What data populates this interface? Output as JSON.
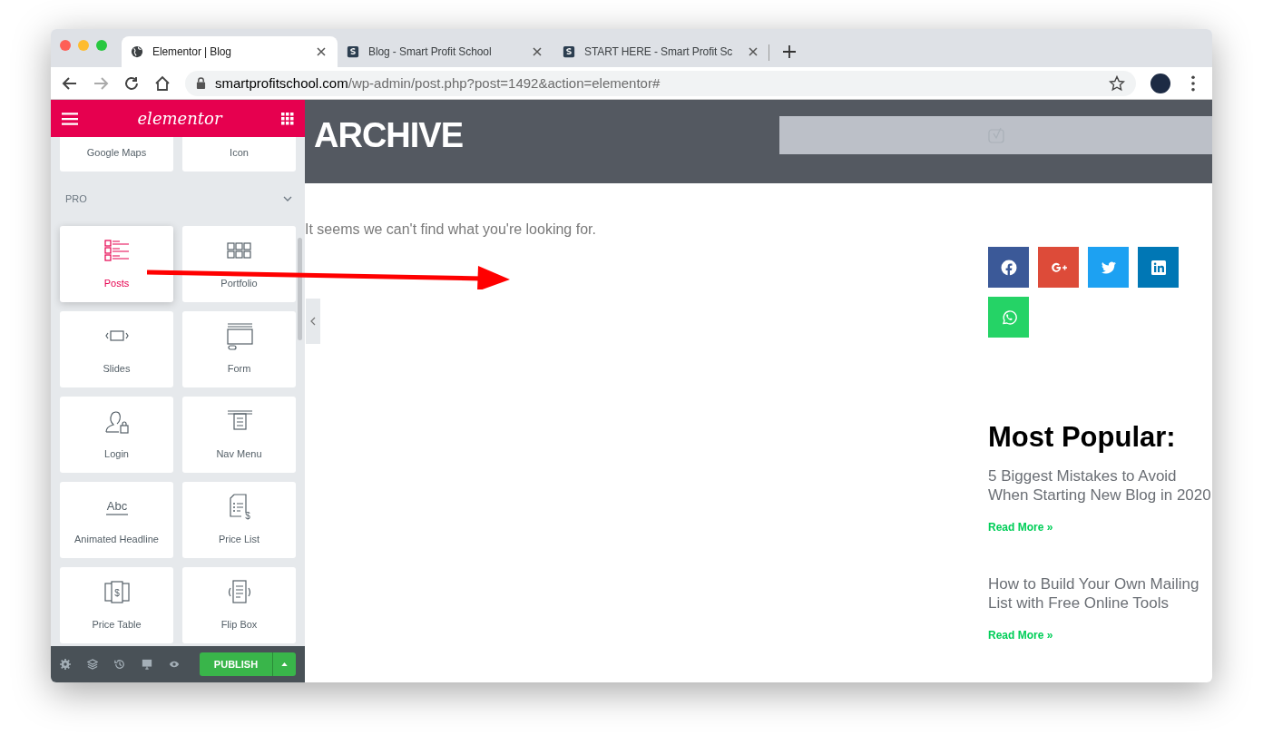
{
  "browser": {
    "tabs": [
      {
        "title": "Elementor | Blog",
        "kind": "globe",
        "selected": true
      },
      {
        "title": "Blog - Smart Profit School",
        "kind": "site",
        "selected": false
      },
      {
        "title": "START HERE - Smart Profit Sc",
        "kind": "site",
        "selected": false
      }
    ],
    "address": {
      "domain": "smartprofitschool.com",
      "path": "/wp-admin/post.php?post=1492&action=elementor#"
    }
  },
  "sidebar": {
    "logo": "elementor",
    "top_widgets": [
      {
        "label": "Google Maps"
      },
      {
        "label": "Icon"
      }
    ],
    "section": {
      "title": "PRO",
      "expanded": true
    },
    "widgets": [
      {
        "label": "Posts",
        "kind": "posts",
        "selected": true
      },
      {
        "label": "Portfolio",
        "kind": "portfolio",
        "selected": false
      },
      {
        "label": "Slides",
        "kind": "slides",
        "selected": false
      },
      {
        "label": "Form",
        "kind": "form",
        "selected": false
      },
      {
        "label": "Login",
        "kind": "login",
        "selected": false
      },
      {
        "label": "Nav Menu",
        "kind": "nav-menu",
        "selected": false
      },
      {
        "label": "Animated Headline",
        "kind": "headline",
        "glyph": "Abc",
        "selected": false
      },
      {
        "label": "Price List",
        "kind": "price-list",
        "glyph": "$",
        "selected": false
      },
      {
        "label": "Price Table",
        "kind": "price-table",
        "glyph": "$",
        "selected": false
      },
      {
        "label": "Flip Box",
        "kind": "flip-box",
        "selected": false
      }
    ],
    "publish": "PUBLISH"
  },
  "page": {
    "heading": "ARCHIVE",
    "message": "It seems we can't find what you're looking for.",
    "share_buttons": [
      {
        "kind": "facebook",
        "color": "#3b5998"
      },
      {
        "kind": "google-plus",
        "color": "#dd4b39"
      },
      {
        "kind": "twitter",
        "color": "#1da1f2"
      },
      {
        "kind": "linkedin",
        "color": "#0077b5"
      },
      {
        "kind": "whatsapp",
        "color": "#25d366"
      }
    ],
    "popular": {
      "heading": "Most Popular:",
      "posts": [
        {
          "title": "5 Biggest Mistakes to Avoid When Starting New Blog in 2020",
          "link": "Read More »"
        },
        {
          "title": "How to Build Your Own Mailing List with Free Online Tools",
          "link": "Read More »"
        }
      ]
    }
  }
}
